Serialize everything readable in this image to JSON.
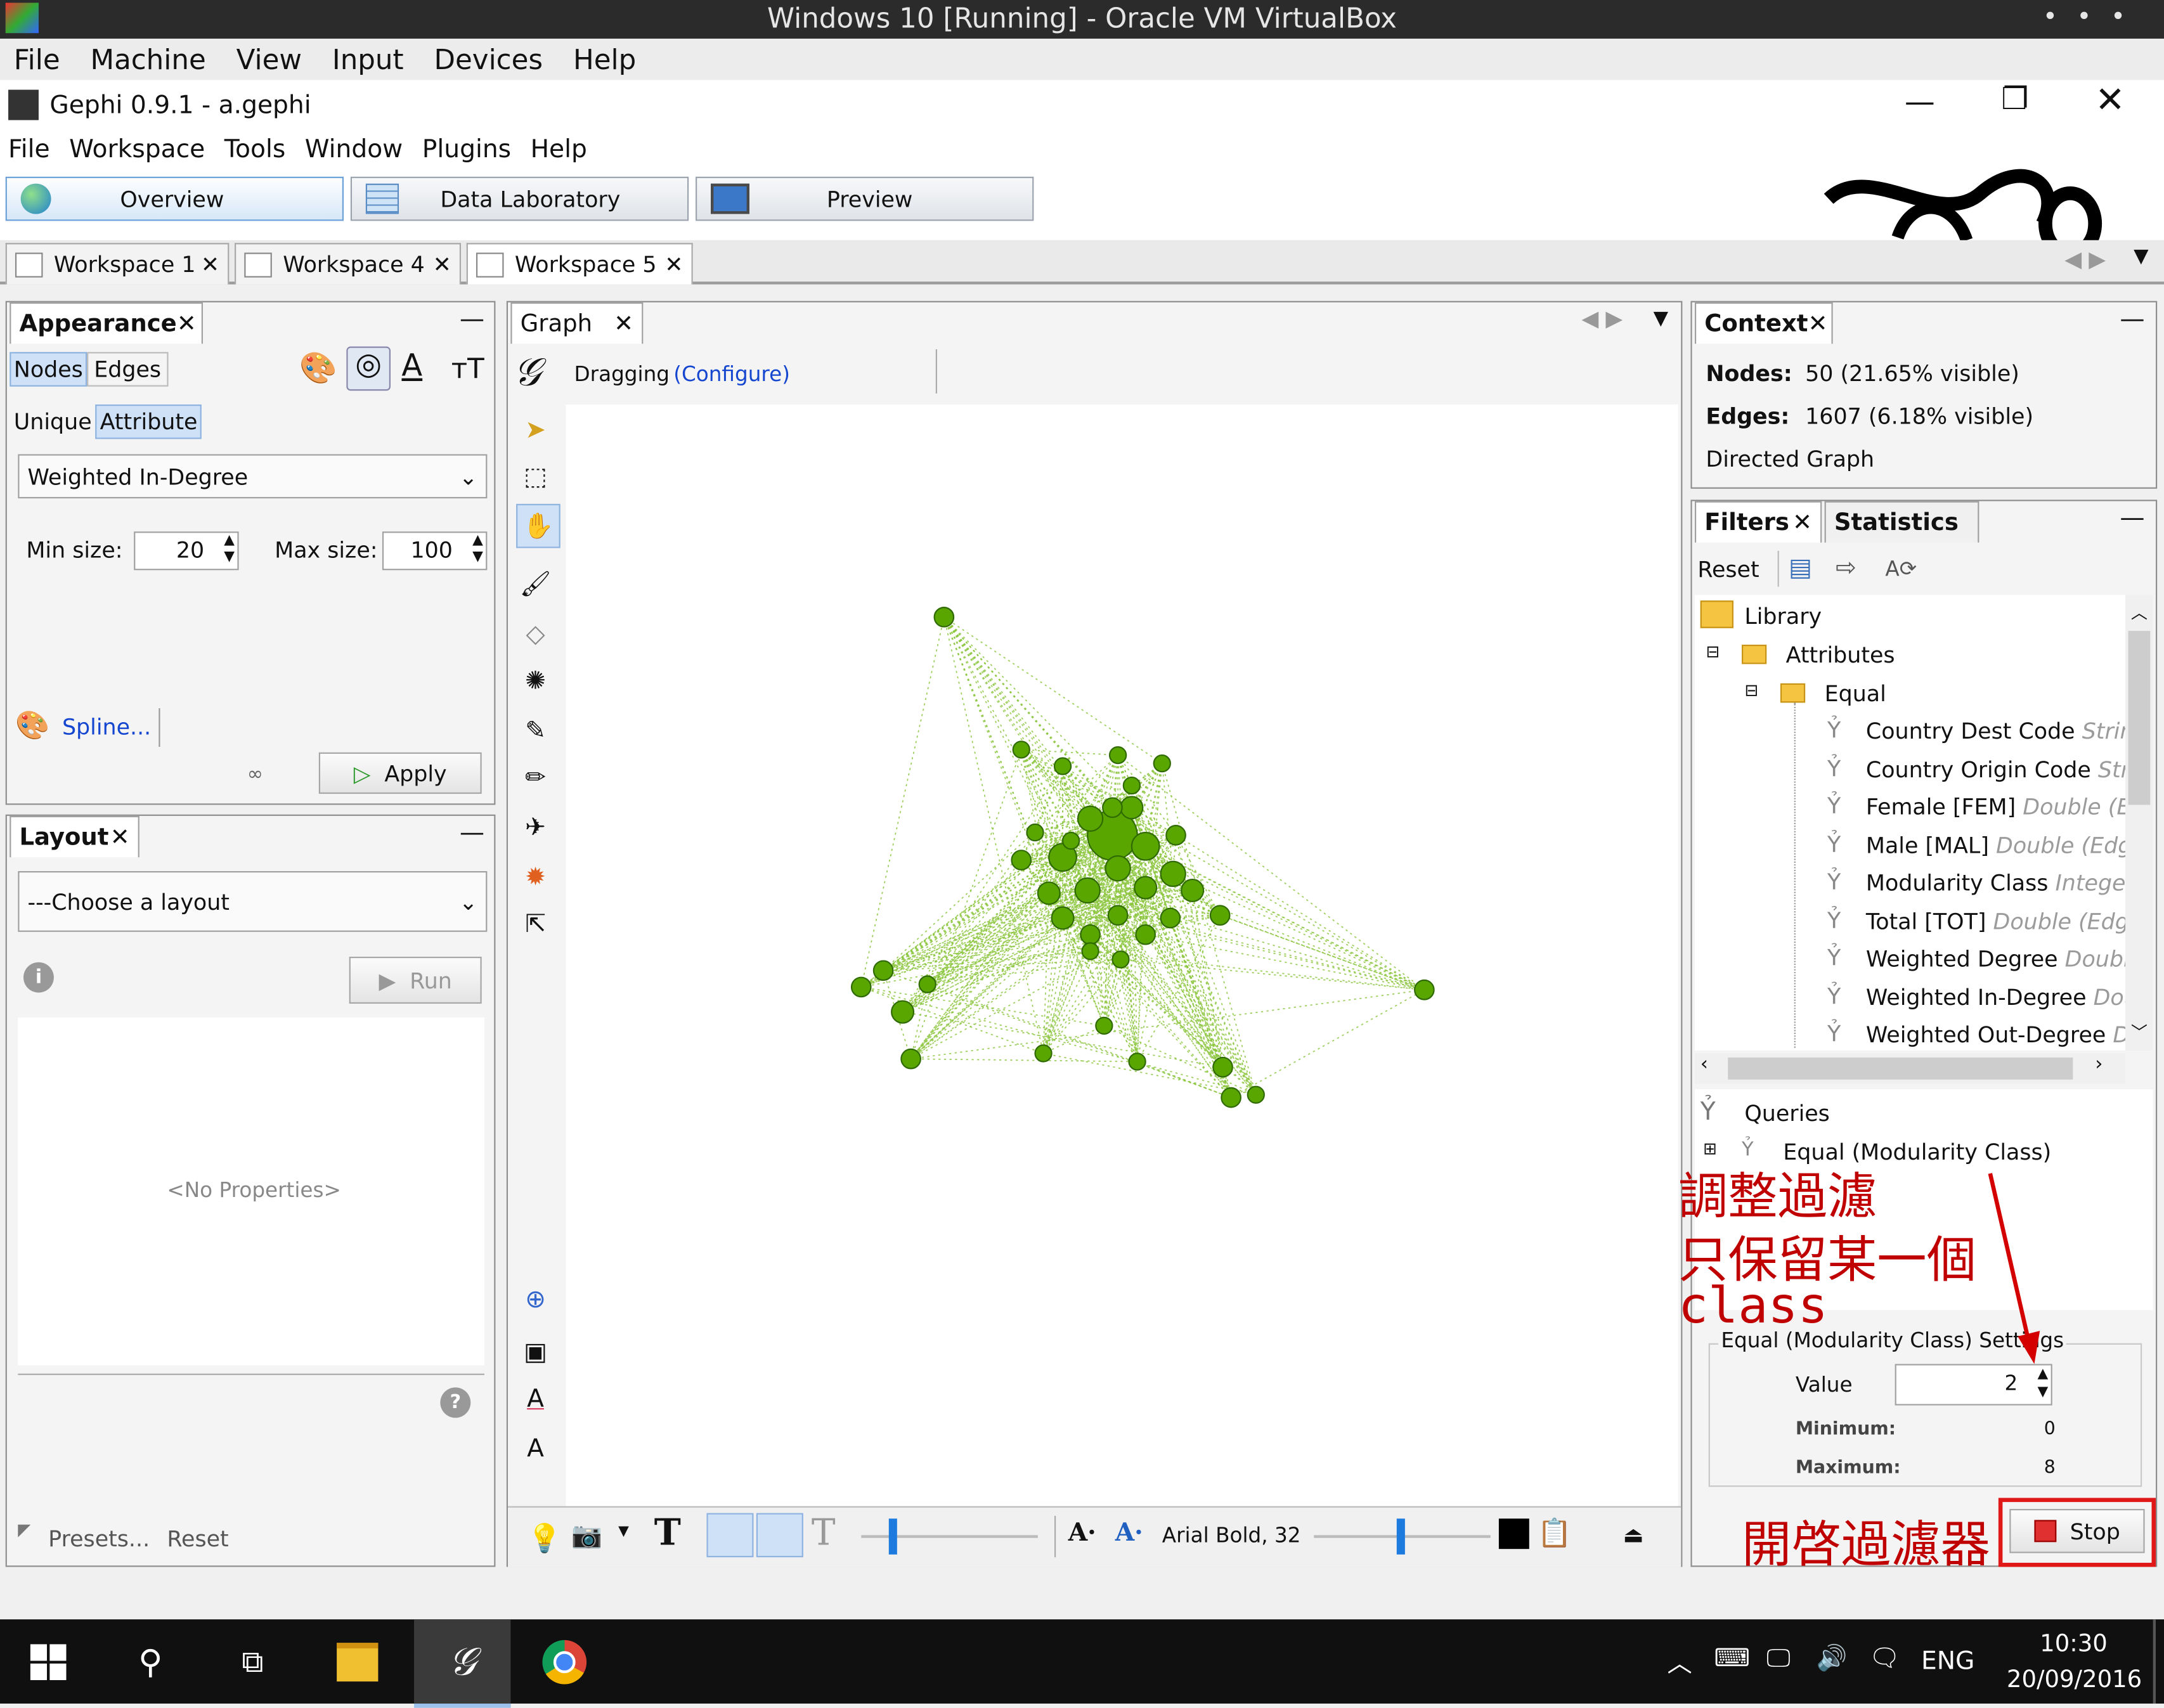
{
  "vbox": {
    "title": "Windows 10 [Running] - Oracle VM VirtualBox",
    "menu": [
      "File",
      "Machine",
      "View",
      "Input",
      "Devices",
      "Help"
    ]
  },
  "app": {
    "title": "Gephi 0.9.1 - a.gephi",
    "menu": [
      "File",
      "Workspace",
      "Tools",
      "Window",
      "Plugins",
      "Help"
    ],
    "modes": [
      "Overview",
      "Data Laboratory",
      "Preview"
    ],
    "workspaces": [
      "Workspace 1",
      "Workspace 4",
      "Workspace 5"
    ]
  },
  "appearance": {
    "title": "Appearance",
    "tabs": [
      "Nodes",
      "Edges"
    ],
    "subtabs": [
      "Unique",
      "Attribute"
    ],
    "attribute": "Weighted In-Degree",
    "min_label": "Min size:",
    "min_value": "20",
    "max_label": "Max size:",
    "max_value": "100",
    "spline": "Spline...",
    "apply": "Apply"
  },
  "layout": {
    "title": "Layout",
    "choose": "---Choose a layout",
    "run": "Run",
    "no_props": "<No Properties>",
    "presets": "Presets...",
    "reset": "Reset"
  },
  "graph": {
    "tab": "Graph",
    "mode": "Dragging",
    "configure": "(Configure)",
    "font": "Arial Bold, 32",
    "node_color": "#5aa600",
    "edge_color": "#8cc63f"
  },
  "context": {
    "title": "Context",
    "nodes_label": "Nodes:",
    "nodes_value": "50 (21.65% visible)",
    "edges_label": "Edges:",
    "edges_value": "1607 (6.18% visible)",
    "type": "Directed Graph"
  },
  "filters": {
    "tabs": [
      "Filters",
      "Statistics"
    ],
    "reset": "Reset",
    "library": "Library",
    "attributes": "Attributes",
    "equal": "Equal",
    "items": [
      {
        "name": "Country Dest Code",
        "type": "String"
      },
      {
        "name": "Country Origin Code",
        "type": "String"
      },
      {
        "name": "Female [FEM]",
        "type": "Double (Edge)"
      },
      {
        "name": "Male [MAL]",
        "type": "Double (Edge)"
      },
      {
        "name": "Modularity Class",
        "type": "Integer"
      },
      {
        "name": "Total [TOT]",
        "type": "Double (Edge)"
      },
      {
        "name": "Weighted Degree",
        "type": "Double"
      },
      {
        "name": "Weighted In-Degree",
        "type": "Double"
      },
      {
        "name": "Weighted Out-Degree",
        "type": "Double"
      }
    ],
    "queries": "Queries",
    "query_item": "Equal (Modularity Class)",
    "settings_title": "Equal (Modularity Class) Settings",
    "value_label": "Value",
    "value": "2",
    "minimum_label": "Minimum:",
    "minimum": "0",
    "maximum_label": "Maximum:",
    "maximum": "8",
    "stop": "Stop"
  },
  "annotations": {
    "line1": "調整過濾",
    "line2": "只保留某一個",
    "line3": "class",
    "enable": "開啓過濾器",
    "color": "#d40000"
  },
  "taskbar": {
    "lang": "ENG",
    "time": "10:30",
    "date": "20/09/2016"
  }
}
